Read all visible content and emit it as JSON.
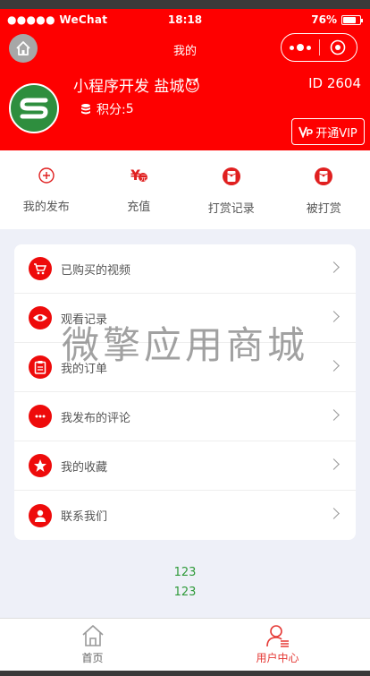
{
  "status_bar": {
    "carrier": "●●●●● WeChat",
    "time": "18:18",
    "battery": "76%"
  },
  "nav": {
    "title": "我的"
  },
  "profile": {
    "name": "小程序开发 盐城😈",
    "points_label": "积分:",
    "points_value": "5",
    "id_label": "ID 2604",
    "vip_label": "开通VIP"
  },
  "quick_actions": [
    {
      "label": "我的发布",
      "icon": "plus-circle-icon"
    },
    {
      "label": "充值",
      "icon": "yen-icon"
    },
    {
      "label": "打赏记录",
      "icon": "red-envelope-icon"
    },
    {
      "label": "被打赏",
      "icon": "red-envelope-icon"
    }
  ],
  "menu": [
    {
      "label": "已购买的视频",
      "icon": "cart-icon"
    },
    {
      "label": "观看记录",
      "icon": "eye-icon"
    },
    {
      "label": "我的订单",
      "icon": "clipboard-icon"
    },
    {
      "label": "我发布的评论",
      "icon": "comment-icon"
    },
    {
      "label": "我的收藏",
      "icon": "star-icon"
    },
    {
      "label": "联系我们",
      "icon": "user-icon"
    }
  ],
  "watermark": "微擎应用商城",
  "footer": {
    "line1": "123",
    "line2": "123"
  },
  "tabs": [
    {
      "label": "首页",
      "icon": "home-icon"
    },
    {
      "label": "用户中心",
      "icon": "user-center-icon"
    }
  ],
  "colors": {
    "brand_red": "#fe0000",
    "tab_active": "#e53935",
    "footer_text": "#2f9a3a"
  }
}
